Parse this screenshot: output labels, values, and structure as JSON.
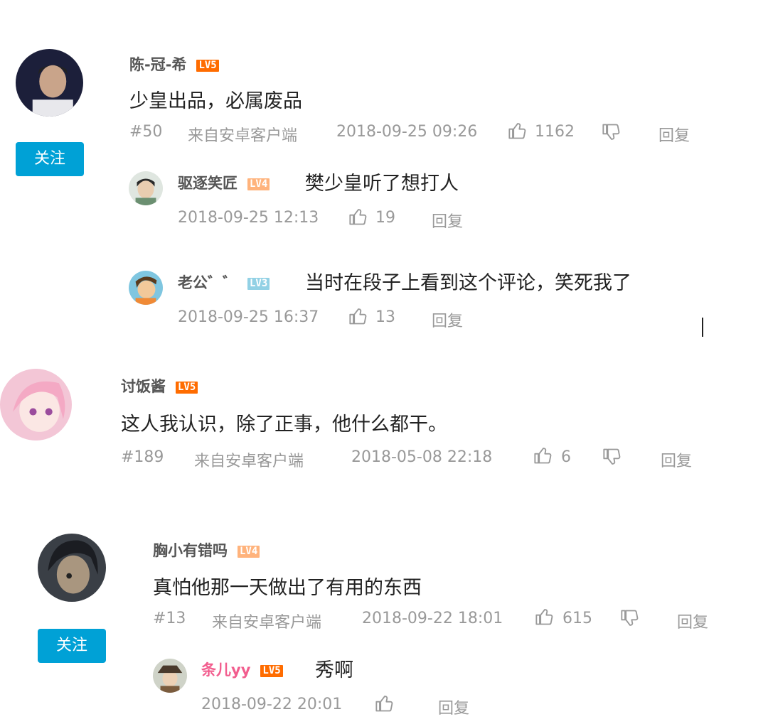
{
  "comments": [
    {
      "username": "陈-冠-希",
      "level": "LV5",
      "content": "少皇出品，必属废品",
      "floor": "#50",
      "source": "来自安卓客户端",
      "time": "2018-09-25 09:26",
      "likes": "1162",
      "reply_label": "回复",
      "follow_label": "关注",
      "replies": [
        {
          "username": "驱逐笑匠",
          "level": "LV4",
          "content": "樊少皇听了想打人",
          "time": "2018-09-25 12:13",
          "likes": "19",
          "reply_label": "回复"
        },
        {
          "username": "老公゛゛",
          "level": "LV3",
          "content": "当时在段子上看到这个评论，笑死我了",
          "time": "2018-09-25 16:37",
          "likes": "13",
          "reply_label": "回复"
        }
      ]
    },
    {
      "username": "讨饭酱",
      "level": "LV5",
      "content": "这人我认识，除了正事，他什么都干。",
      "floor": "#189",
      "source": "来自安卓客户端",
      "time": "2018-05-08 22:18",
      "likes": "6",
      "reply_label": "回复"
    },
    {
      "username": "胸小有错吗",
      "level": "LV4",
      "content": "真怕他那一天做出了有用的东西",
      "floor": "#13",
      "source": "来自安卓客户端",
      "time": "2018-09-22 18:01",
      "likes": "615",
      "reply_label": "回复",
      "follow_label": "关注",
      "replies": [
        {
          "username": "条儿yy",
          "level": "LV5",
          "content": "秀啊",
          "time": "2018-09-22 20:01",
          "likes": "",
          "reply_label": "回复"
        }
      ]
    }
  ]
}
